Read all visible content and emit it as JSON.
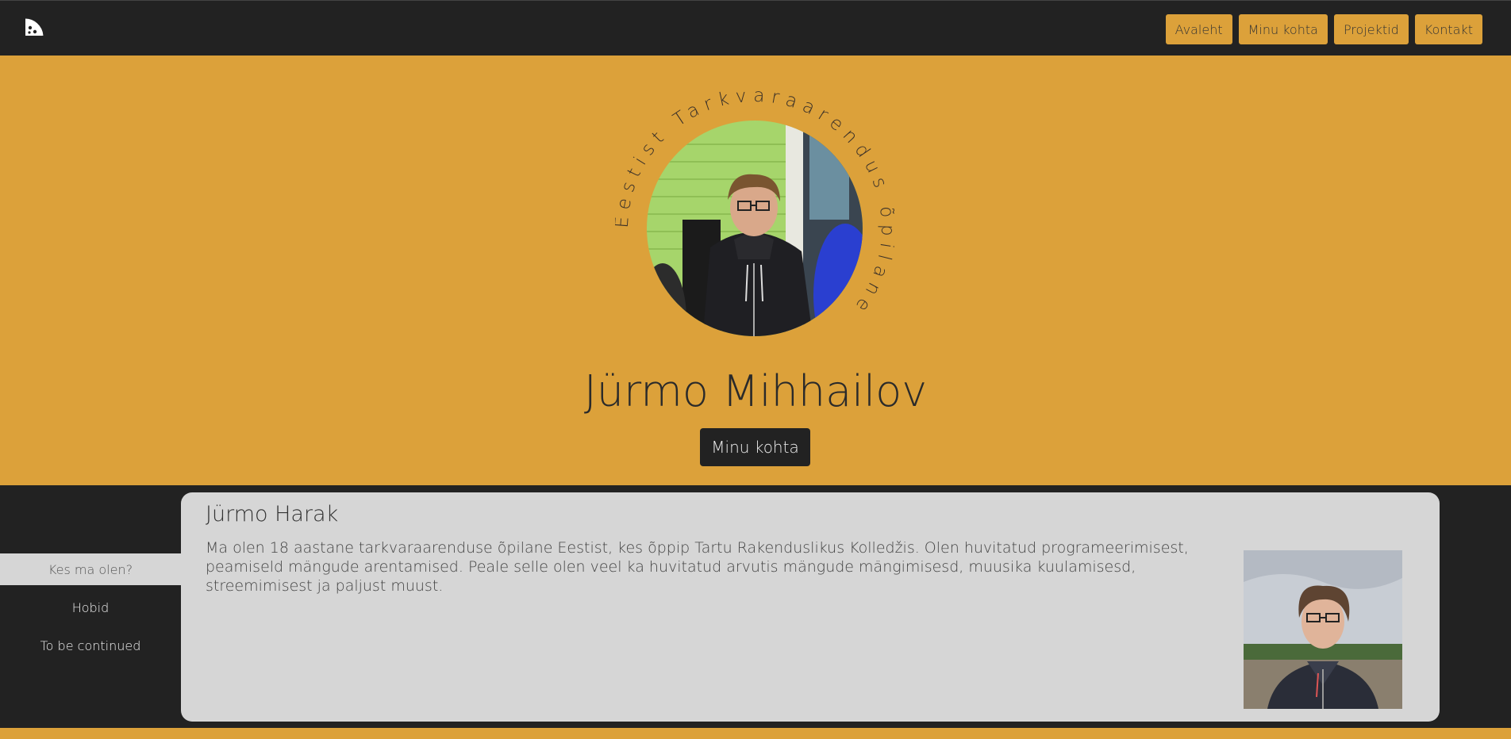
{
  "nav": {
    "logo_icon": "pizza-slice-icon",
    "links": [
      "Avaleht",
      "Minu kohta",
      "Projektid",
      "Kontakt"
    ]
  },
  "hero": {
    "ring_text": "Eestist Tarkvaraarendus õpilane",
    "title": "Jürmo Mihhailov",
    "button_label": "Minu kohta",
    "background_color": "#dca13a"
  },
  "sidebar": {
    "items": [
      "Kes ma olen?",
      "Hobid",
      "To be continued"
    ]
  },
  "content": {
    "title": "Jürmo Harak",
    "text": "Ma olen 18 aastane tarkvaraarenduse õpilane Eestist, kes õppip Tartu Rakenduslikus Kolledžis. Olen huvitatud programeerimisest, peamiseld mängude arentamised. Peale selle olen veel ka huvitatud arvutis mängude mängimisesd, muusika kuulamisesd, streemimisest ja paljust muust."
  },
  "colors": {
    "accent": "#dca13a",
    "dark": "#222222",
    "card": "#d6d6d6"
  }
}
